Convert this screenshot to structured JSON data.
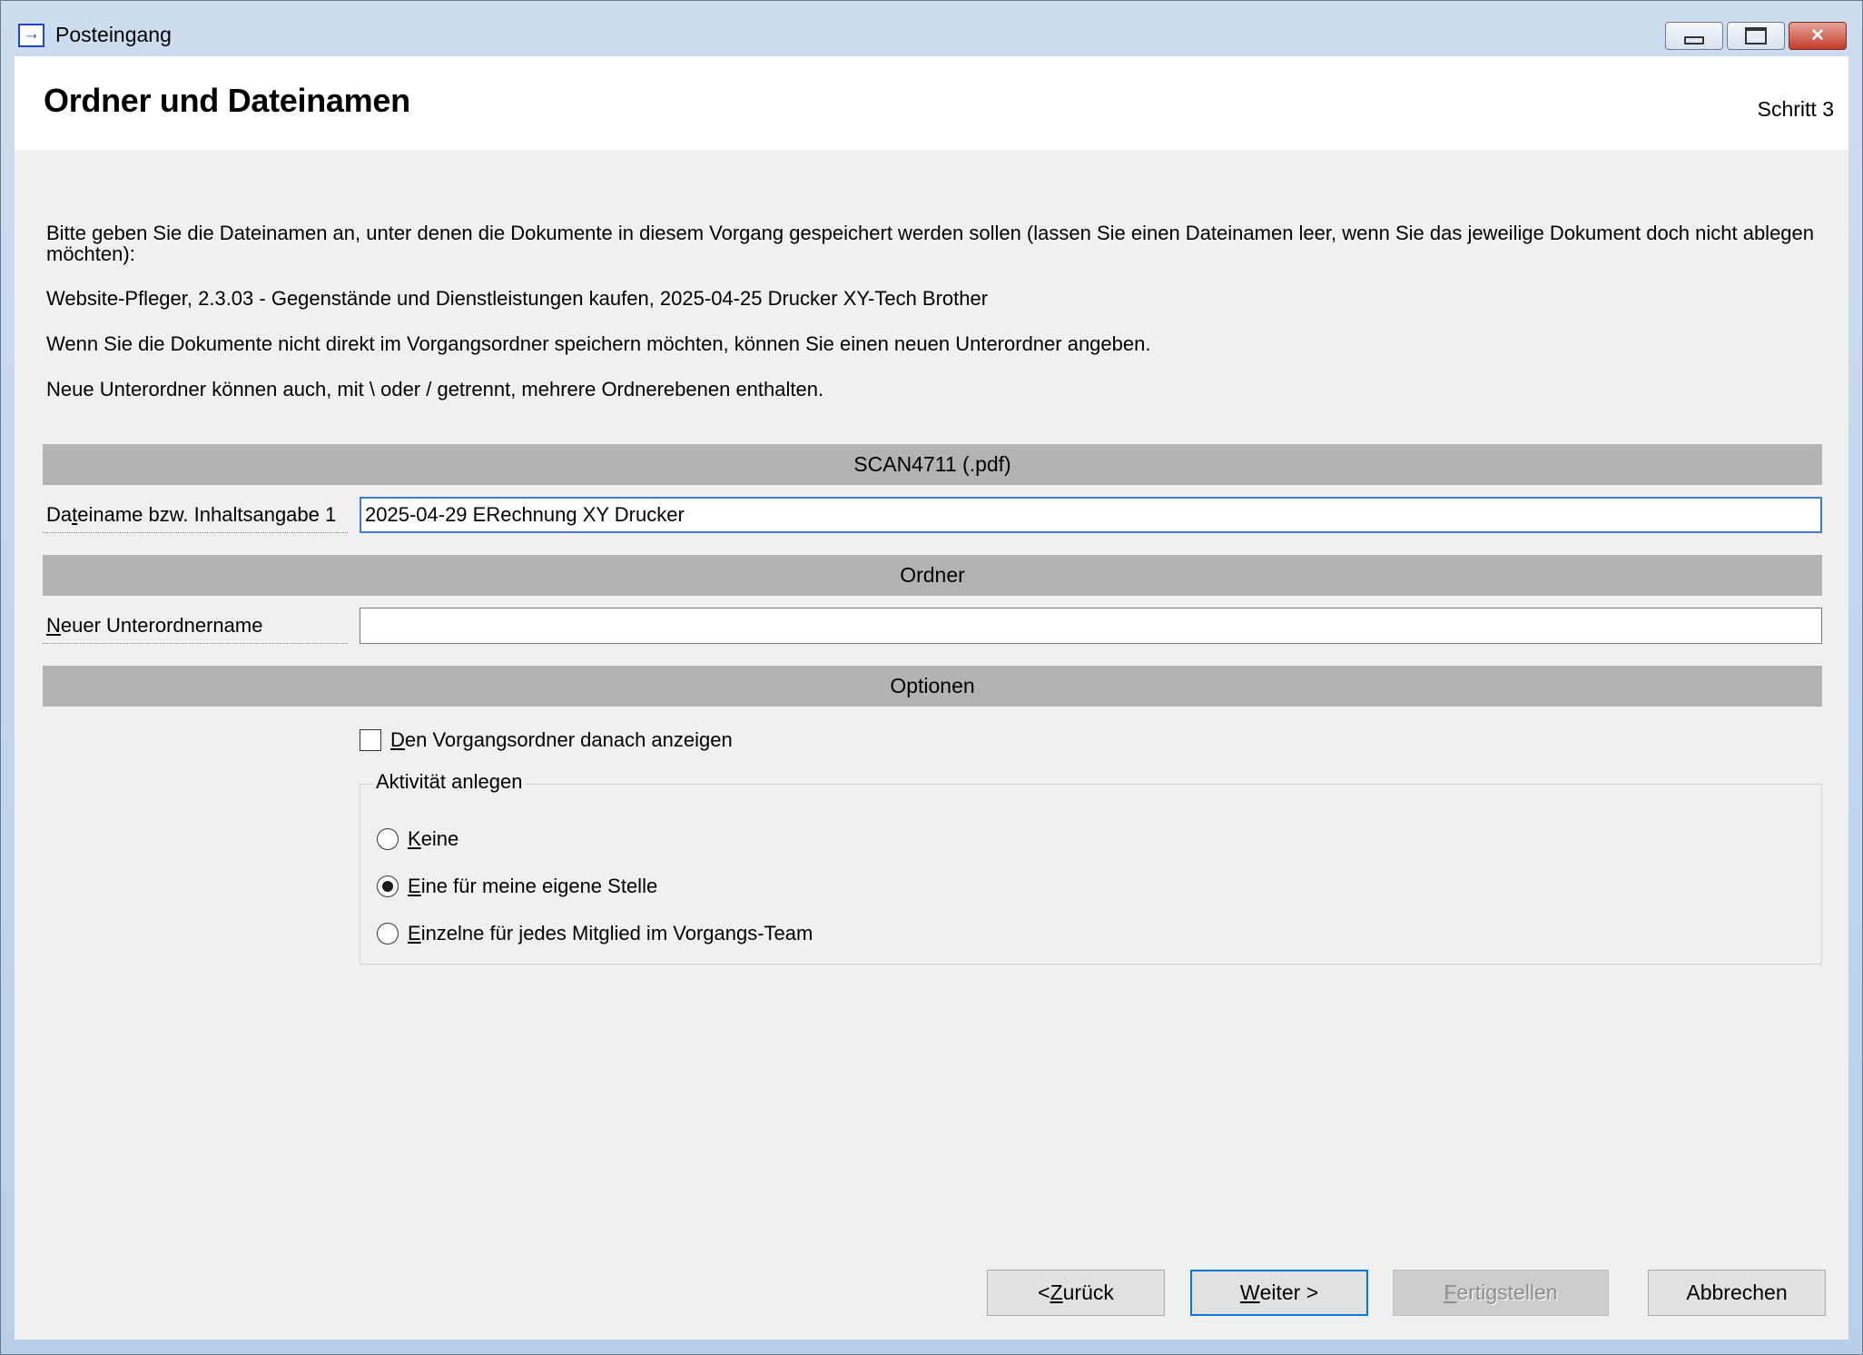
{
  "window": {
    "title": "Posteingang"
  },
  "header": {
    "title": "Ordner und Dateinamen",
    "step": "Schritt 3"
  },
  "intro": {
    "p1": "Bitte geben Sie die Dateinamen an, unter denen die Dokumente in diesem Vorgang gespeichert werden sollen (lassen Sie einen Dateinamen leer, wenn Sie das jeweilige Dokument doch nicht ablegen möchten):",
    "p2": "Website-Pfleger, 2.3.03 - Gegenstände und Dienstleistungen kaufen, 2025-04-25 Drucker XY-Tech Brother",
    "p3": "Wenn Sie die Dokumente nicht direkt im Vorgangsordner speichern möchten, können Sie einen neuen Unterordner angeben.",
    "p4": "Neue Unterordner können auch, mit \\ oder / getrennt, mehrere Ordnerebenen enthalten."
  },
  "sections": {
    "file": "SCAN4711 (.pdf)",
    "folder": "Ordner",
    "options": "Optionen"
  },
  "fields": {
    "filename_label_pre": "Da",
    "filename_label_accel": "t",
    "filename_label_post": "einame bzw. Inhaltsangabe 1",
    "filename_value": "2025-04-29 ERechnung XY Drucker",
    "subfolder_label_accel": "N",
    "subfolder_label_post": "euer Unterordnername",
    "subfolder_value": ""
  },
  "options": {
    "show_folder_accel": "D",
    "show_folder_post": "en Vorgangsordner danach anzeigen",
    "show_folder_checked": false,
    "activity_group_label": "Aktivität anlegen",
    "radios": [
      {
        "accel": "K",
        "post": "eine",
        "selected": false
      },
      {
        "accel": "E",
        "post": "ine für meine eigene Stelle",
        "selected": true
      },
      {
        "accel": "E",
        "post": "inzelne für jedes Mitglied im Vorgangs-Team",
        "selected": false
      }
    ]
  },
  "buttons": {
    "back_pre": "< ",
    "back_accel": "Z",
    "back_post": "urück",
    "next_accel": "W",
    "next_post": "eiter >",
    "finish_accel": "F",
    "finish_post": "ertigstellen",
    "cancel": "Abbrechen"
  }
}
